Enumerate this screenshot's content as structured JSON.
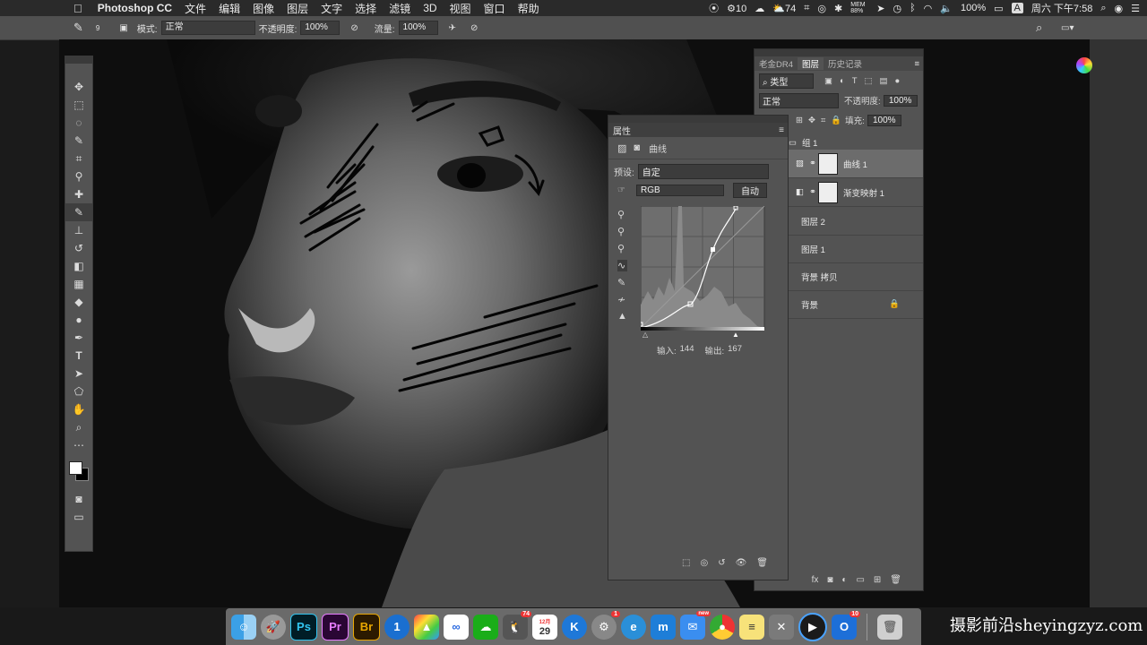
{
  "menubar": {
    "apple": "",
    "app_name": "Photoshop CC",
    "items": [
      "文件",
      "编辑",
      "图像",
      "图层",
      "文字",
      "选择",
      "滤镜",
      "3D",
      "视图",
      "窗口",
      "帮助"
    ],
    "status": {
      "badge1": "10",
      "badge2": "74",
      "mem": "MEM 88%",
      "battery": "100%",
      "input_method": "A",
      "clock": "周六 下午7:58"
    }
  },
  "options_bar": {
    "brush_size": "9",
    "mode_label": "模式:",
    "mode_value": "正常",
    "opacity_label": "不透明度:",
    "opacity_value": "100%",
    "flow_label": "流量:",
    "flow_value": "100%"
  },
  "properties": {
    "title": "属性",
    "adjustment_name": "曲线",
    "preset_label": "预设:",
    "preset_value": "自定",
    "channel_value": "RGB",
    "auto_label": "自动",
    "input_label": "输入:",
    "input_value": "144",
    "output_label": "输出:",
    "output_value": "167"
  },
  "layers_panel": {
    "tabs": [
      "老金DR4",
      "图层",
      "历史记录"
    ],
    "filter_label": "类型",
    "blend_mode": "正常",
    "opacity_label": "不透明度:",
    "opacity_value": "100%",
    "fill_label": "填充:",
    "fill_value": "100%",
    "layers": [
      {
        "name": "组 1"
      },
      {
        "name": "曲线 1"
      },
      {
        "name": "渐变映射 1"
      },
      {
        "name": "图层 2"
      },
      {
        "name": "图层 1"
      },
      {
        "name": "背景 拷贝"
      },
      {
        "name": "背景"
      }
    ]
  },
  "dock": {
    "apps": [
      "Finder",
      "Launchpad",
      "Ps",
      "Pr",
      "Br",
      "1Password",
      "Affinity",
      "Baidu",
      "WeChat",
      "QQ",
      "Calendar",
      "Keynote",
      "Preferences",
      "Edge",
      "Mail",
      "NewBadge",
      "Chrome",
      "Notes",
      "Xcode",
      "QuickTime",
      "Outlook",
      "Trash"
    ],
    "qq_badge": "74",
    "calendar_day": "29",
    "calendar_month": "12月",
    "prefs_badge": "1",
    "new_badge": "new",
    "outlook_badge": "10"
  },
  "watermark": "摄影前沿sheyingzyz.com"
}
